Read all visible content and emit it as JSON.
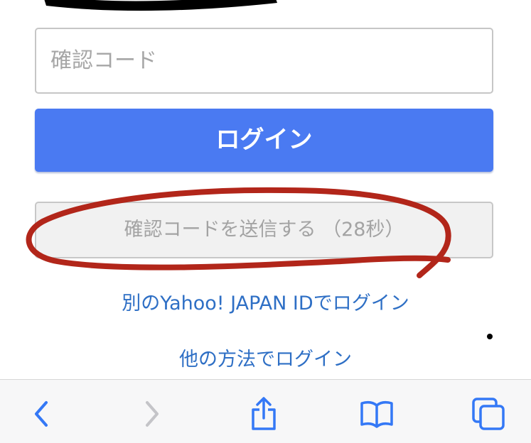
{
  "form": {
    "code_placeholder": "確認コード",
    "login_label": "ログイン",
    "resend_label": "確認コードを送信する （28秒）"
  },
  "links": {
    "other_yahoo_id": "別のYahoo! JAPAN IDでログイン",
    "other_method": "他の方法でログイン"
  },
  "toolbar": {
    "icons": [
      "back-icon",
      "forward-icon",
      "share-icon",
      "bookmarks-icon",
      "tabs-icon"
    ]
  },
  "colors": {
    "login_button": "#4a7af2",
    "link": "#2e6fc5",
    "toolbar_icon": "#3478f6",
    "toolbar_icon_disabled": "#c4c4c8",
    "annotation": "#b2261a"
  }
}
